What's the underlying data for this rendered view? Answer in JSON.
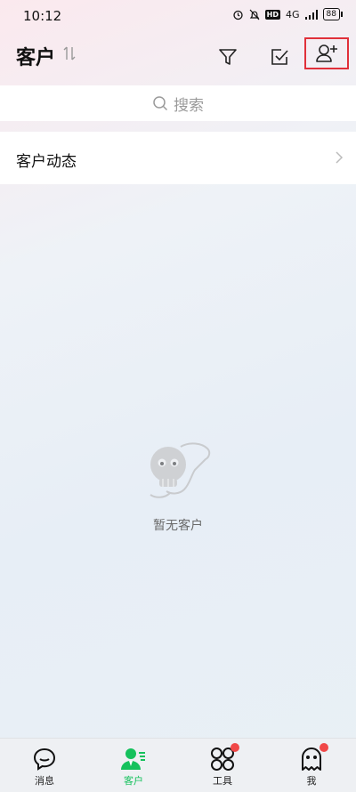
{
  "status": {
    "time": "10:12",
    "network": "HD",
    "signal": "4G",
    "battery": "88"
  },
  "header": {
    "title": "客户"
  },
  "search": {
    "placeholder": "搜索"
  },
  "customer_dynamics": {
    "label": "客户动态"
  },
  "empty_state": {
    "text": "暂无客户"
  },
  "tabs": [
    {
      "label": "消息",
      "icon": "chat-bubble-icon",
      "active": false,
      "badge": false
    },
    {
      "label": "客户",
      "icon": "customer-person-icon",
      "active": true,
      "badge": false
    },
    {
      "label": "工具",
      "icon": "tools-grid-icon",
      "active": false,
      "badge": true
    },
    {
      "label": "我",
      "icon": "ghost-profile-icon",
      "active": false,
      "badge": true
    }
  ],
  "colors": {
    "accent": "#15c15c",
    "badge": "#f04848",
    "highlight": "#e0303a"
  }
}
